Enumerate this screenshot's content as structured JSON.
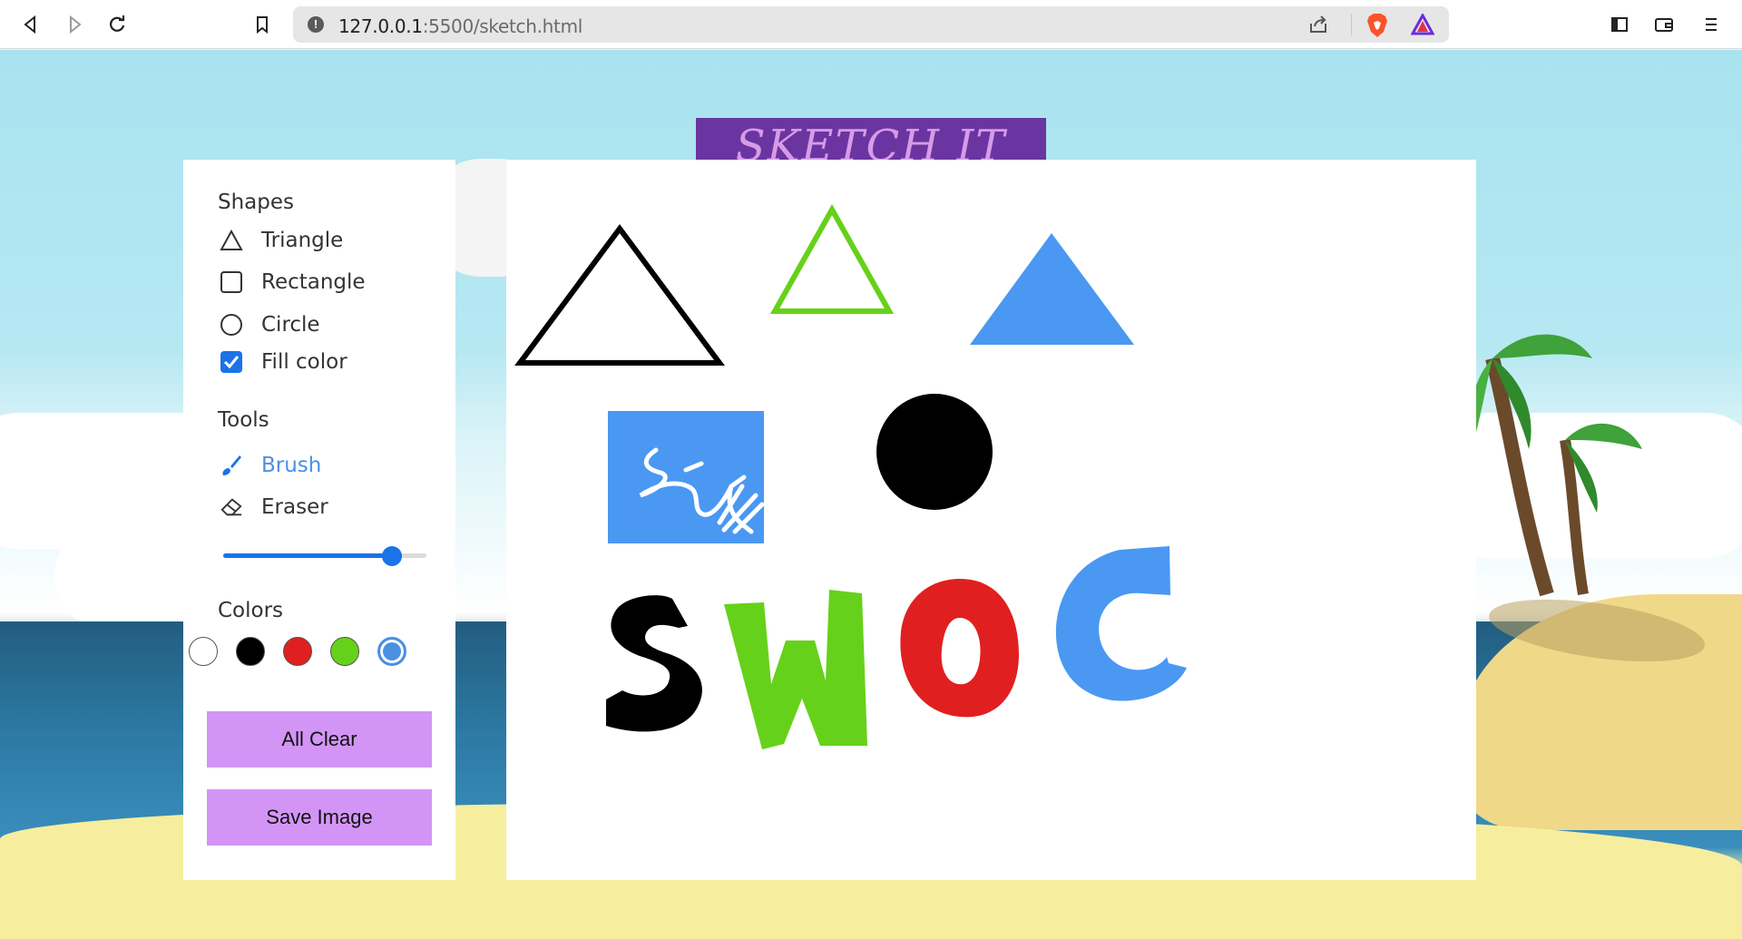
{
  "browser": {
    "url_host": "127.0.0.1",
    "url_path": ":5500/sketch.html",
    "icons": [
      "back-icon",
      "forward-icon",
      "reload-icon",
      "bookmark-icon",
      "site-info-icon",
      "share-icon",
      "brave-shields-icon",
      "brave-rewards-icon",
      "sidebar-icon",
      "wallet-icon",
      "menu-icon"
    ]
  },
  "app": {
    "title": "SKETCH IT"
  },
  "panel": {
    "shapes_title": "Shapes",
    "shapes": [
      {
        "label": "Triangle",
        "icon": "triangle-icon"
      },
      {
        "label": "Rectangle",
        "icon": "rectangle-icon"
      },
      {
        "label": "Circle",
        "icon": "circle-icon"
      }
    ],
    "fill_color": {
      "label": "Fill color",
      "checked": true
    },
    "tools_title": "Tools",
    "tools": [
      {
        "label": "Brush",
        "icon": "brush-icon",
        "active": true
      },
      {
        "label": "Eraser",
        "icon": "eraser-icon",
        "active": false
      }
    ],
    "brush_size": {
      "fraction": 0.83
    },
    "colors_title": "Colors",
    "colors": [
      {
        "hex": "#ffffff",
        "selected": false
      },
      {
        "hex": "#000000",
        "selected": false
      },
      {
        "hex": "#e02020",
        "selected": false
      },
      {
        "hex": "#66d11a",
        "selected": false
      },
      {
        "hex": "#4a90e2",
        "selected": true
      }
    ],
    "clear_label": "All Clear",
    "save_label": "Save Image"
  },
  "canvas": {
    "drawing_text": "SWOC",
    "colors": {
      "black": "#000000",
      "green": "#66d11a",
      "blue": "#4a98f2",
      "red": "#e02020"
    }
  }
}
